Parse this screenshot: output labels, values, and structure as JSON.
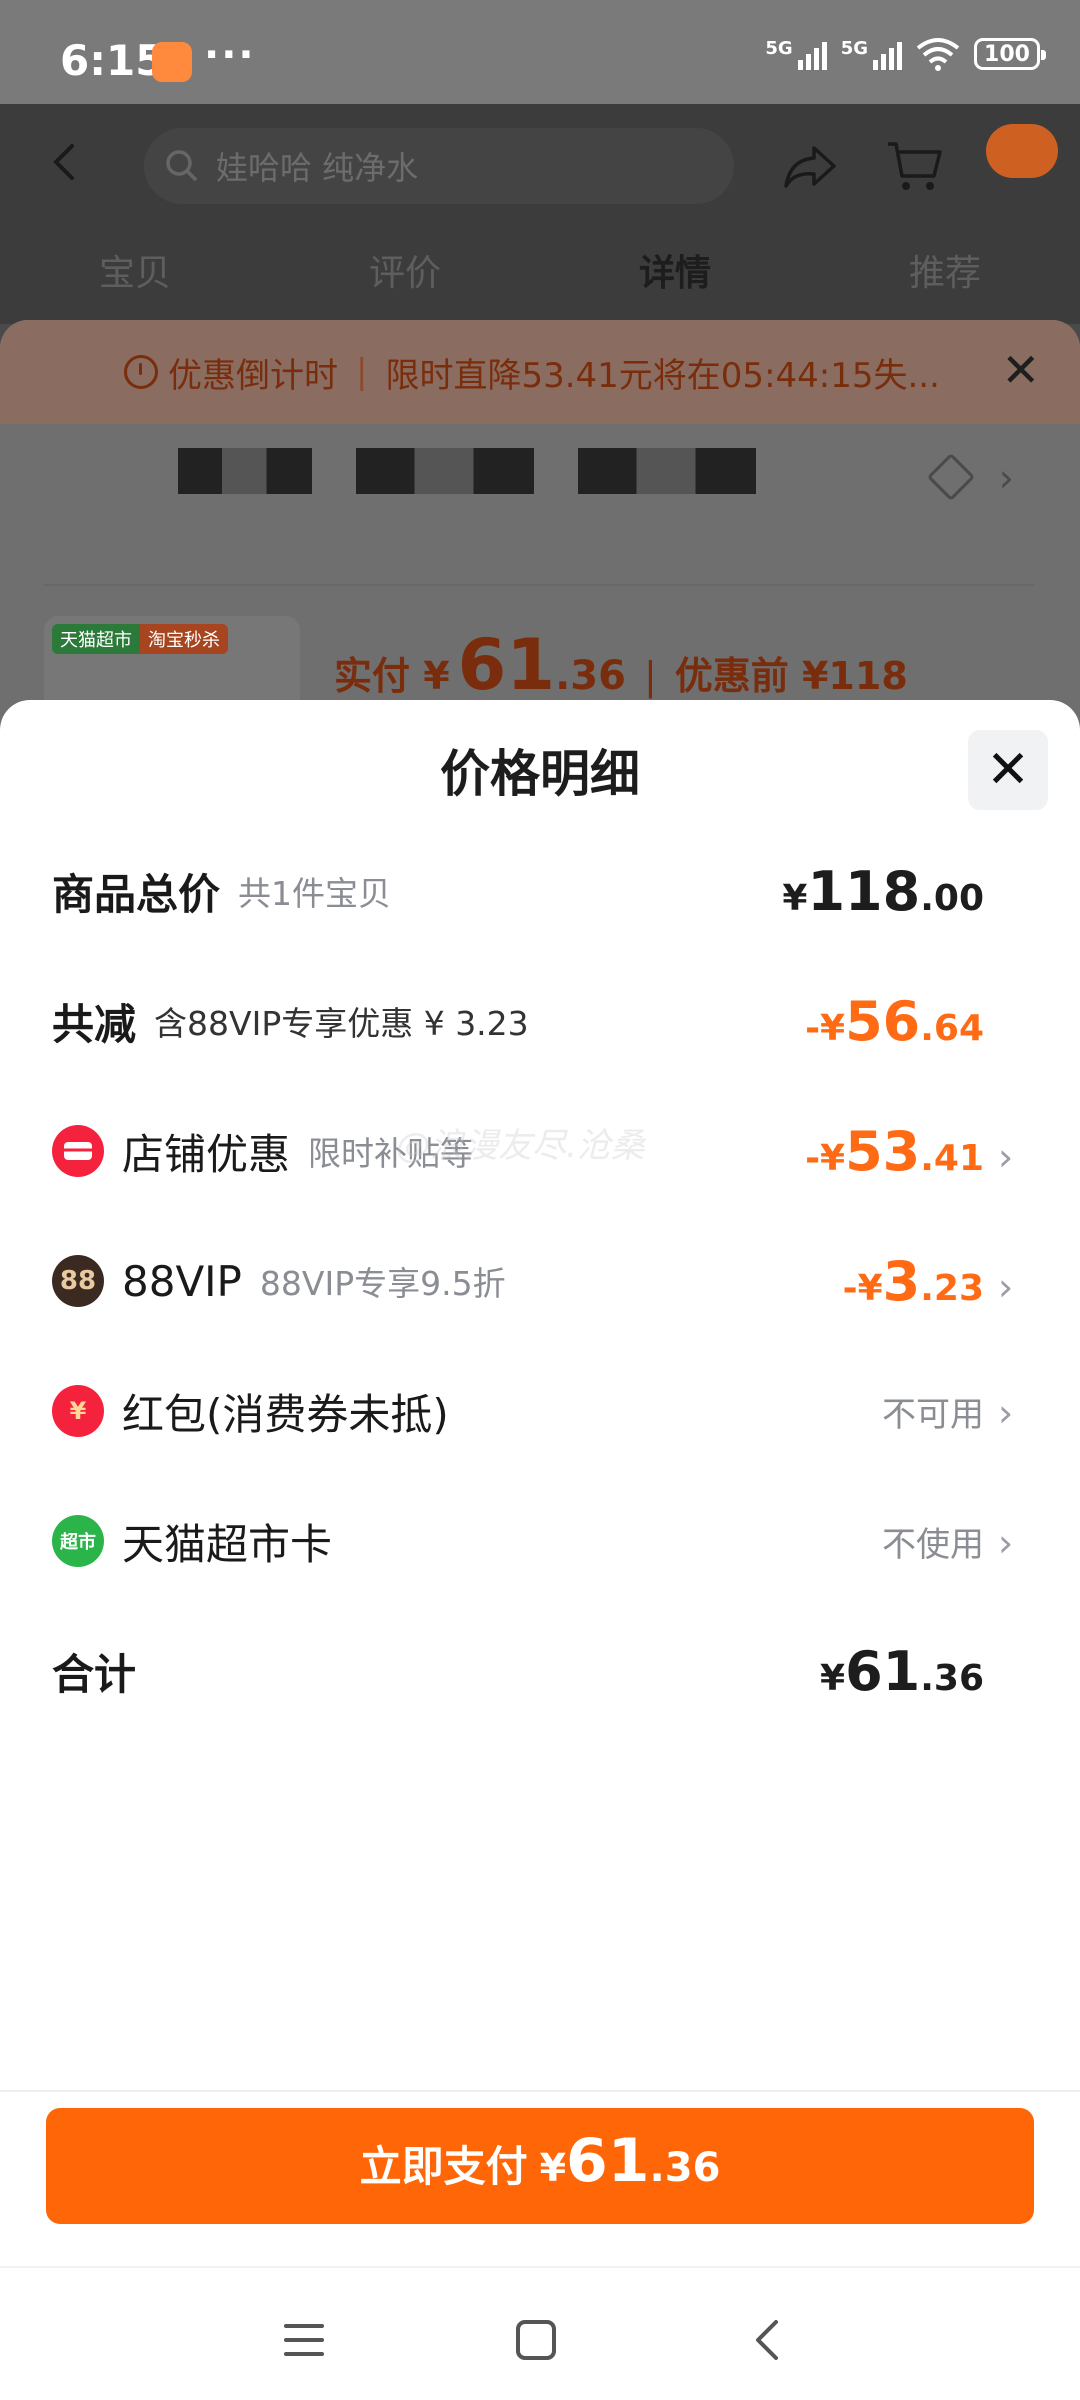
{
  "status_bar": {
    "time": "6:15",
    "dots": "···",
    "net1": "5G",
    "net2": "5G",
    "battery": "100"
  },
  "background_page": {
    "search_placeholder": "娃哈哈 纯净水",
    "tabs": [
      "宝贝",
      "评价",
      "详情",
      "推荐"
    ],
    "active_tab": "详情",
    "countdown_label": "优惠倒计时",
    "countdown_text": "限时直降53.41元将在05:44:15失...",
    "product_tag_1": "天猫超市",
    "product_tag_2": "淘宝秒杀",
    "paid_label": "实付 ¥",
    "paid_int": "61",
    "paid_dec": ".36",
    "before_label": "优惠前 ¥118"
  },
  "sheet": {
    "title": "价格明细",
    "watermark": "@浪漫友尽.沧桑",
    "rows": {
      "total": {
        "label": "商品总价",
        "sub": "共1件宝贝",
        "sym": "¥",
        "int": "118",
        "dec": ".00"
      },
      "reduce": {
        "label": "共减",
        "sub": "含88VIP专享优惠 ¥ 3.23",
        "sym": "-¥",
        "int": "56",
        "dec": ".64"
      },
      "shop": {
        "icon": "shop-coupon-icon",
        "label": "店铺优惠",
        "sub": "限时补贴等",
        "sym": "-¥",
        "int": "53",
        "dec": ".41"
      },
      "vip": {
        "icon": "88vip-icon",
        "icon_text": "88",
        "label": "88VIP",
        "sub": "88VIP专享9.5折",
        "sym": "-¥",
        "int": "3",
        "dec": ".23"
      },
      "redpacket": {
        "icon": "red-packet-icon",
        "icon_text": "¥",
        "label": "红包(消费券未抵)",
        "status": "不可用"
      },
      "card": {
        "icon": "supermarket-card-icon",
        "icon_text": "超市",
        "label": "天猫超市卡",
        "status": "不使用"
      },
      "sum": {
        "label": "合计",
        "sym": "¥",
        "int": "61",
        "dec": ".36"
      }
    },
    "pay_button": {
      "label": "立即支付",
      "sym": "¥",
      "int": "61",
      "dec": ".36"
    }
  },
  "colors": {
    "accent": "#ff6607",
    "discount": "#ff6a14",
    "shop_icon": "#f5223d",
    "vip_icon": "#3a2a22",
    "card_icon": "#2bb44a"
  }
}
